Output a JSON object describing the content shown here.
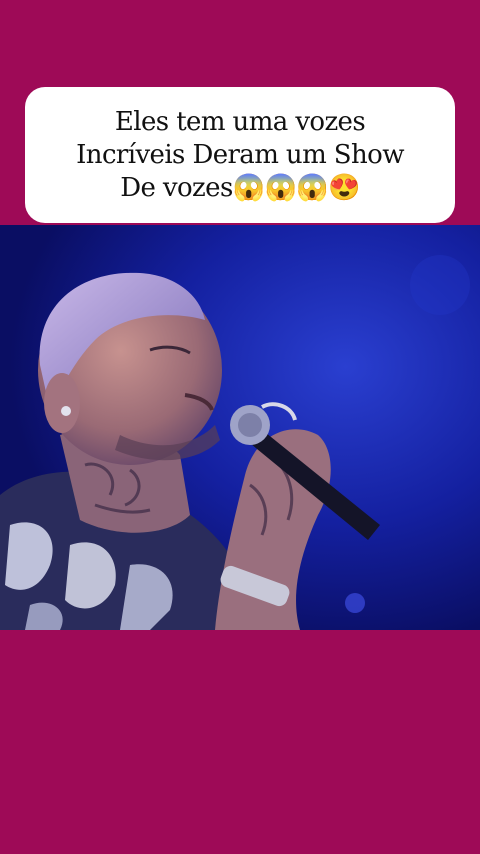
{
  "caption": {
    "line1": "Eles tem uma vozes",
    "line2": "Incríveis Deram um Show",
    "line3": "De vozes😱😱😱😍"
  },
  "colors": {
    "background": "#9e0a57",
    "caption_bg": "#ffffff",
    "caption_text": "#111111",
    "stage_blue": "#10147a"
  },
  "video": {
    "icon": "singer-with-microphone-photo"
  }
}
